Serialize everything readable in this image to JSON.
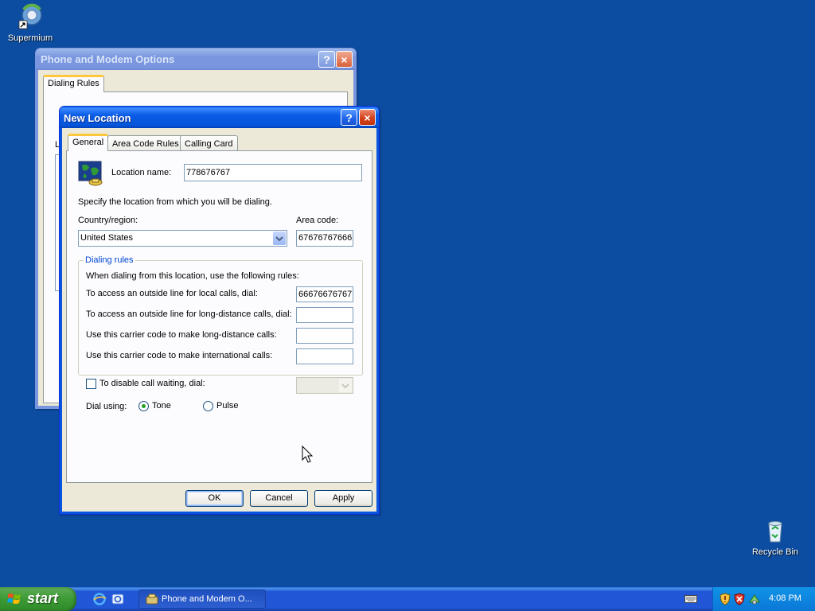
{
  "desktop": {
    "icon_top_label": "Supermium",
    "icon_bottom_label": "Recycle Bin"
  },
  "bg_window": {
    "title": "Phone and Modem Options",
    "help_glyph": "?",
    "close_glyph": "×",
    "tab_label": "Dialing Rules",
    "partial_letter": "L"
  },
  "dialog": {
    "title": "New Location",
    "help_glyph": "?",
    "close_glyph": "×",
    "tabs": [
      "General",
      "Area Code Rules",
      "Calling Card"
    ],
    "location_name_label": "Location name:",
    "location_name_value": "778676767",
    "specify_text": "Specify the location from which you will be dialing.",
    "country_label": "Country/region:",
    "country_value": "United States",
    "area_code_label": "Area code:",
    "area_code_value": "67676767666",
    "dialing_rules_title": "Dialing rules",
    "dialing_intro": "When dialing from this location, use the following rules:",
    "rules": [
      {
        "label": "To access an outside line for local calls, dial:",
        "value": "66676676767"
      },
      {
        "label": "To access an outside line for long-distance calls, dial:",
        "value": ""
      },
      {
        "label": "Use this carrier code to make long-distance calls:",
        "value": ""
      },
      {
        "label": "Use this carrier code to make international calls:",
        "value": ""
      }
    ],
    "call_waiting_label": "To disable call waiting, dial:",
    "dial_using_label": "Dial using:",
    "tone_label": "Tone",
    "pulse_label": "Pulse",
    "ok_label": "OK",
    "cancel_label": "Cancel",
    "apply_label": "Apply"
  },
  "taskbar": {
    "start_label": "start",
    "task_label": "Phone and Modem O...",
    "clock": "4:08 PM"
  },
  "colors": {
    "desktop": "#0d4da1",
    "titlebar": "#0a5fe8",
    "dialog_face": "#ece9d8",
    "taskbar": "#2157d7",
    "start_green": "#3c9a34"
  }
}
